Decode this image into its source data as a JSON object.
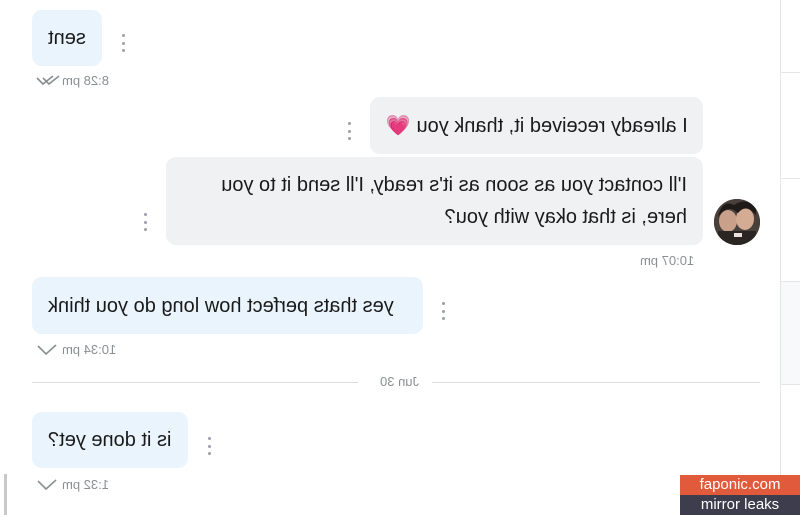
{
  "conversation": {
    "messages": [
      {
        "text": "sent",
        "time": "8:28 pm",
        "side": "incoming"
      },
      {
        "text": "I already received it, thank you 💗",
        "time": "",
        "side": "outgoing"
      },
      {
        "text": "I'll contact you as soon as it's ready, I'll send it to you here, is that okay with you?",
        "time": "10:07 pm",
        "side": "outgoing"
      },
      {
        "text": "yes thats perfect how long do you think",
        "time": "10:34 pm",
        "side": "incoming"
      },
      {
        "text": "is it done yet?",
        "time": "1:32 pm",
        "side": "incoming"
      }
    ],
    "date_separator": "Jun 30"
  },
  "watermark": {
    "site": "faponic.com",
    "tagline": "mirror leaks"
  },
  "colors": {
    "incoming_bubble": "#e9f4fc",
    "outgoing_bubble": "#f0f1f3",
    "meta_text": "#8a8f94",
    "watermark_top": "#e25a3c",
    "watermark_bottom": "#3d3d4d"
  },
  "icons": {
    "read_receipt": "double-check-icon",
    "sent_receipt": "check-icon",
    "menu": "kebab-menu-icon"
  }
}
